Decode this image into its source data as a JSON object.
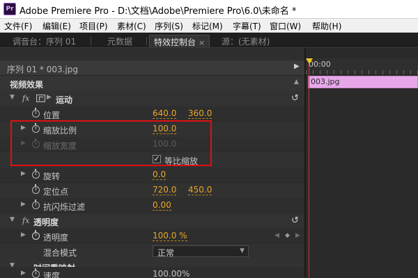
{
  "window": {
    "app_icon": "Pr",
    "title": "Adobe Premiere Pro - D:\\文档\\Adobe\\Premiere Pro\\6.0\\未命名 *"
  },
  "menu": {
    "items": [
      {
        "label": "文件(F)"
      },
      {
        "label": "编辑(E)"
      },
      {
        "label": "项目(P)"
      },
      {
        "label": "素材(C)"
      },
      {
        "label": "序列(S)"
      },
      {
        "label": "标记(M)"
      },
      {
        "label": "字幕(T)"
      },
      {
        "label": "窗口(W)"
      },
      {
        "label": "帮助(H)"
      }
    ]
  },
  "tabs": [
    {
      "label": "调音台：序列 01",
      "active": false
    },
    {
      "label": "元数据",
      "active": false
    },
    {
      "label": "特效控制台",
      "active": true,
      "close": "×"
    },
    {
      "label": "源：(无素材)",
      "active": false
    }
  ],
  "effect_controls": {
    "sequence_label": "序列 01 * 003.jpg",
    "section_video": "视频效果",
    "motion": {
      "fx": "fx",
      "label": "运动",
      "position": {
        "label": "位置",
        "x": "640.0",
        "y": "360.0"
      },
      "scale": {
        "label": "缩放比例",
        "value": "100.0"
      },
      "scale_width": {
        "label": "缩放宽度",
        "value": "100.0"
      },
      "uniform_scale": {
        "label": "等比缩放",
        "checked": true,
        "check": "✓"
      },
      "rotation": {
        "label": "旋转",
        "value": "0.0"
      },
      "anchor": {
        "label": "定位点",
        "x": "720.0",
        "y": "450.0"
      },
      "antiflicker": {
        "label": "抗闪烁过滤",
        "value": "0.00"
      }
    },
    "opacity": {
      "fx": "fx",
      "label": "透明度",
      "opacity": {
        "label": "透明度",
        "value": "100.0 %"
      },
      "blend_mode": {
        "label": "混合模式",
        "value": "正常"
      }
    },
    "time_remap": {
      "label": "时间重映射",
      "speed": {
        "label": "速度",
        "value": "100.00%"
      }
    },
    "reset_icon": "↺"
  },
  "timeline": {
    "time_label": "00:00",
    "clip_name": "003.jpg",
    "playhead_color": "#f5c518",
    "clip_color": "#e7a7e9"
  },
  "colors": {
    "value_orange": "#e8a72a",
    "highlight_red": "#e01010"
  }
}
